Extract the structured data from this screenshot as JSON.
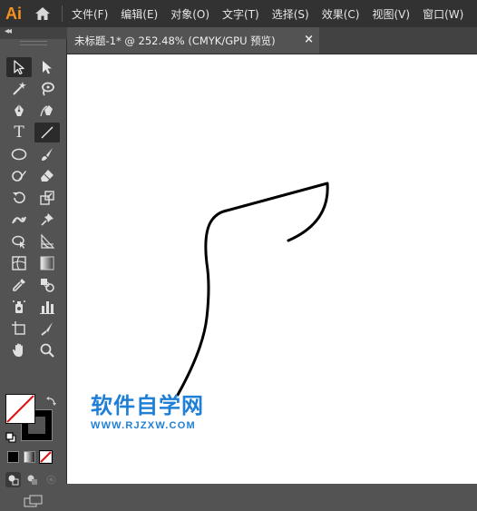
{
  "app": {
    "logo_text": "Ai",
    "logo_color": "#f7921e",
    "home_icon": "home-icon"
  },
  "menu": {
    "items": [
      "文件(F)",
      "编辑(E)",
      "对象(O)",
      "文字(T)",
      "选择(S)",
      "效果(C)",
      "视图(V)",
      "窗口(W)"
    ]
  },
  "document_tab": {
    "title": "未标题-1* @ 252.48% (CMYK/GPU 预览)",
    "close_icon": "×"
  },
  "toolbar": {
    "collapse_icon": "◂◂",
    "tools": [
      {
        "left": "selection-tool",
        "right": "direct-selection-tool"
      },
      {
        "left": "magic-wand-tool",
        "right": "lasso-tool"
      },
      {
        "left": "pen-tool",
        "right": "curvature-tool"
      },
      {
        "left": "type-tool",
        "right": "line-segment-tool"
      },
      {
        "left": "ellipse-tool",
        "right": "paintbrush-tool"
      },
      {
        "left": "shaper-tool",
        "right": "eraser-tool"
      },
      {
        "left": "rotate-tool",
        "right": "scale-tool"
      },
      {
        "left": "puppet-warp-tool",
        "right": "free-transform-tool"
      },
      {
        "left": "shape-builder-tool",
        "right": "perspective-grid-tool"
      },
      {
        "left": "mesh-tool",
        "right": "gradient-tool"
      },
      {
        "left": "eyedropper-tool",
        "right": "blend-tool"
      },
      {
        "left": "symbol-sprayer-tool",
        "right": "column-graph-tool"
      },
      {
        "left": "artboard-tool",
        "right": "slice-tool"
      },
      {
        "left": "hand-tool",
        "right": "zoom-tool"
      }
    ],
    "type_tool_label": "T",
    "fill_color": "none",
    "stroke_color": "#000000"
  },
  "watermark": {
    "title": "软件自学网",
    "url": "WWW.RJZXW.COM",
    "color": "#1f7fd6"
  }
}
